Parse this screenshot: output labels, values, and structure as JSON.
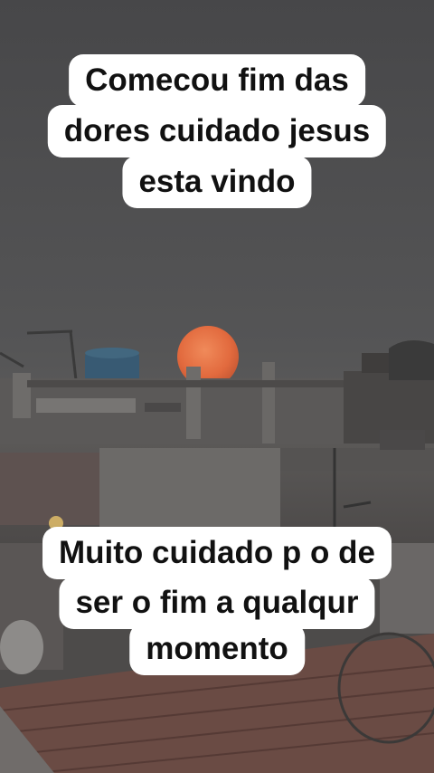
{
  "scene": {
    "description_icon": "photo-moonrise-over-rooftops",
    "colors": {
      "sky_top": "#4b4b4d",
      "sky_mid": "#565658",
      "sky_horizon": "#62605f",
      "moon": "#e36a3d",
      "moon_glow": "#f08a5a",
      "buildings": "#5d5b5a",
      "buildings_dark": "#3d3b3b",
      "rooftop": "#6b4c45"
    }
  },
  "captions": {
    "top": {
      "lines": [
        "Comecou fim das",
        "dores cuidado jesus",
        "esta vindo"
      ]
    },
    "bottom": {
      "lines": [
        "Muito cuidado p o de",
        "ser o fim a qualqur",
        "momento"
      ]
    }
  }
}
